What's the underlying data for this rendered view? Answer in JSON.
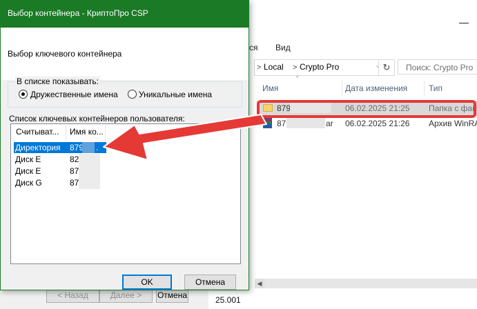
{
  "explorer": {
    "menu_left": "ся",
    "menu_view": "Вид",
    "address": {
      "location": "Local",
      "folder": "Crypto Pro",
      "sep": ">"
    },
    "search_placeholder": "Поиск: Crypto Pro",
    "columns": {
      "name": "Имя",
      "date": "Дата изменения",
      "type": "Тип"
    },
    "rows": [
      {
        "name": "879",
        "date": "06.02.2025 21:25",
        "type": "Папка с фай"
      },
      {
        "name": "87",
        "name_suffix": "ar",
        "date": "06.02.2025 21:26",
        "type": "Архив WinRA"
      }
    ],
    "status_value": "25.001"
  },
  "wizard": {
    "back": "< Назад",
    "next": "Далее >",
    "cancel": "Отмена"
  },
  "dialog": {
    "title": "Выбор контейнера - КриптоПро CSP",
    "subtitle": "Выбор ключевого контейнера",
    "show_group": "В списке показывать:",
    "radio_friendly": "Дружественные имена",
    "radio_unique": "Уникальные имена",
    "list_label": "Список ключевых контейнеров пользователя:",
    "columns": {
      "reader": "Считыват...",
      "name": "Имя ко..."
    },
    "rows": [
      {
        "reader": "Директория",
        "name": "879",
        "suffix": "."
      },
      {
        "reader": "Диск E",
        "name": "82"
      },
      {
        "reader": "Диск E",
        "name": "87"
      },
      {
        "reader": "Диск G",
        "name": "87"
      }
    ],
    "ok": "OK",
    "cancel": "Отмена"
  },
  "colors": {
    "titlebar": "#1a7a26",
    "selection": "#0078d7",
    "highlight_arrow": "#e53935"
  }
}
